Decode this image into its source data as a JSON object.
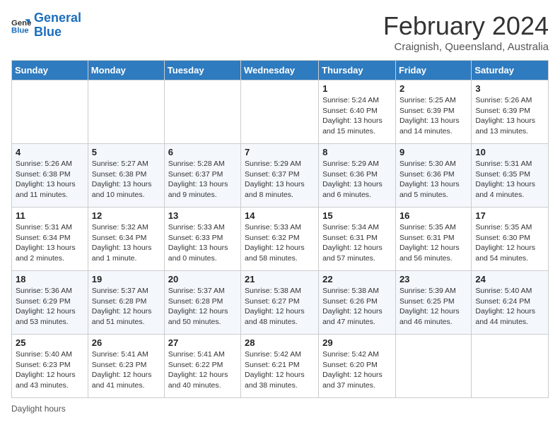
{
  "header": {
    "logo_general": "General",
    "logo_blue": "Blue",
    "month_title": "February 2024",
    "subtitle": "Craignish, Queensland, Australia"
  },
  "days_of_week": [
    "Sunday",
    "Monday",
    "Tuesday",
    "Wednesday",
    "Thursday",
    "Friday",
    "Saturday"
  ],
  "weeks": [
    [
      {
        "day": "",
        "info": ""
      },
      {
        "day": "",
        "info": ""
      },
      {
        "day": "",
        "info": ""
      },
      {
        "day": "",
        "info": ""
      },
      {
        "day": "1",
        "info": "Sunrise: 5:24 AM\nSunset: 6:40 PM\nDaylight: 13 hours and 15 minutes."
      },
      {
        "day": "2",
        "info": "Sunrise: 5:25 AM\nSunset: 6:39 PM\nDaylight: 13 hours and 14 minutes."
      },
      {
        "day": "3",
        "info": "Sunrise: 5:26 AM\nSunset: 6:39 PM\nDaylight: 13 hours and 13 minutes."
      }
    ],
    [
      {
        "day": "4",
        "info": "Sunrise: 5:26 AM\nSunset: 6:38 PM\nDaylight: 13 hours and 11 minutes."
      },
      {
        "day": "5",
        "info": "Sunrise: 5:27 AM\nSunset: 6:38 PM\nDaylight: 13 hours and 10 minutes."
      },
      {
        "day": "6",
        "info": "Sunrise: 5:28 AM\nSunset: 6:37 PM\nDaylight: 13 hours and 9 minutes."
      },
      {
        "day": "7",
        "info": "Sunrise: 5:29 AM\nSunset: 6:37 PM\nDaylight: 13 hours and 8 minutes."
      },
      {
        "day": "8",
        "info": "Sunrise: 5:29 AM\nSunset: 6:36 PM\nDaylight: 13 hours and 6 minutes."
      },
      {
        "day": "9",
        "info": "Sunrise: 5:30 AM\nSunset: 6:36 PM\nDaylight: 13 hours and 5 minutes."
      },
      {
        "day": "10",
        "info": "Sunrise: 5:31 AM\nSunset: 6:35 PM\nDaylight: 13 hours and 4 minutes."
      }
    ],
    [
      {
        "day": "11",
        "info": "Sunrise: 5:31 AM\nSunset: 6:34 PM\nDaylight: 13 hours and 2 minutes."
      },
      {
        "day": "12",
        "info": "Sunrise: 5:32 AM\nSunset: 6:34 PM\nDaylight: 13 hours and 1 minute."
      },
      {
        "day": "13",
        "info": "Sunrise: 5:33 AM\nSunset: 6:33 PM\nDaylight: 13 hours and 0 minutes."
      },
      {
        "day": "14",
        "info": "Sunrise: 5:33 AM\nSunset: 6:32 PM\nDaylight: 12 hours and 58 minutes."
      },
      {
        "day": "15",
        "info": "Sunrise: 5:34 AM\nSunset: 6:31 PM\nDaylight: 12 hours and 57 minutes."
      },
      {
        "day": "16",
        "info": "Sunrise: 5:35 AM\nSunset: 6:31 PM\nDaylight: 12 hours and 56 minutes."
      },
      {
        "day": "17",
        "info": "Sunrise: 5:35 AM\nSunset: 6:30 PM\nDaylight: 12 hours and 54 minutes."
      }
    ],
    [
      {
        "day": "18",
        "info": "Sunrise: 5:36 AM\nSunset: 6:29 PM\nDaylight: 12 hours and 53 minutes."
      },
      {
        "day": "19",
        "info": "Sunrise: 5:37 AM\nSunset: 6:28 PM\nDaylight: 12 hours and 51 minutes."
      },
      {
        "day": "20",
        "info": "Sunrise: 5:37 AM\nSunset: 6:28 PM\nDaylight: 12 hours and 50 minutes."
      },
      {
        "day": "21",
        "info": "Sunrise: 5:38 AM\nSunset: 6:27 PM\nDaylight: 12 hours and 48 minutes."
      },
      {
        "day": "22",
        "info": "Sunrise: 5:38 AM\nSunset: 6:26 PM\nDaylight: 12 hours and 47 minutes."
      },
      {
        "day": "23",
        "info": "Sunrise: 5:39 AM\nSunset: 6:25 PM\nDaylight: 12 hours and 46 minutes."
      },
      {
        "day": "24",
        "info": "Sunrise: 5:40 AM\nSunset: 6:24 PM\nDaylight: 12 hours and 44 minutes."
      }
    ],
    [
      {
        "day": "25",
        "info": "Sunrise: 5:40 AM\nSunset: 6:23 PM\nDaylight: 12 hours and 43 minutes."
      },
      {
        "day": "26",
        "info": "Sunrise: 5:41 AM\nSunset: 6:23 PM\nDaylight: 12 hours and 41 minutes."
      },
      {
        "day": "27",
        "info": "Sunrise: 5:41 AM\nSunset: 6:22 PM\nDaylight: 12 hours and 40 minutes."
      },
      {
        "day": "28",
        "info": "Sunrise: 5:42 AM\nSunset: 6:21 PM\nDaylight: 12 hours and 38 minutes."
      },
      {
        "day": "29",
        "info": "Sunrise: 5:42 AM\nSunset: 6:20 PM\nDaylight: 12 hours and 37 minutes."
      },
      {
        "day": "",
        "info": ""
      },
      {
        "day": "",
        "info": ""
      }
    ]
  ],
  "footer": {
    "daylight_label": "Daylight hours"
  }
}
